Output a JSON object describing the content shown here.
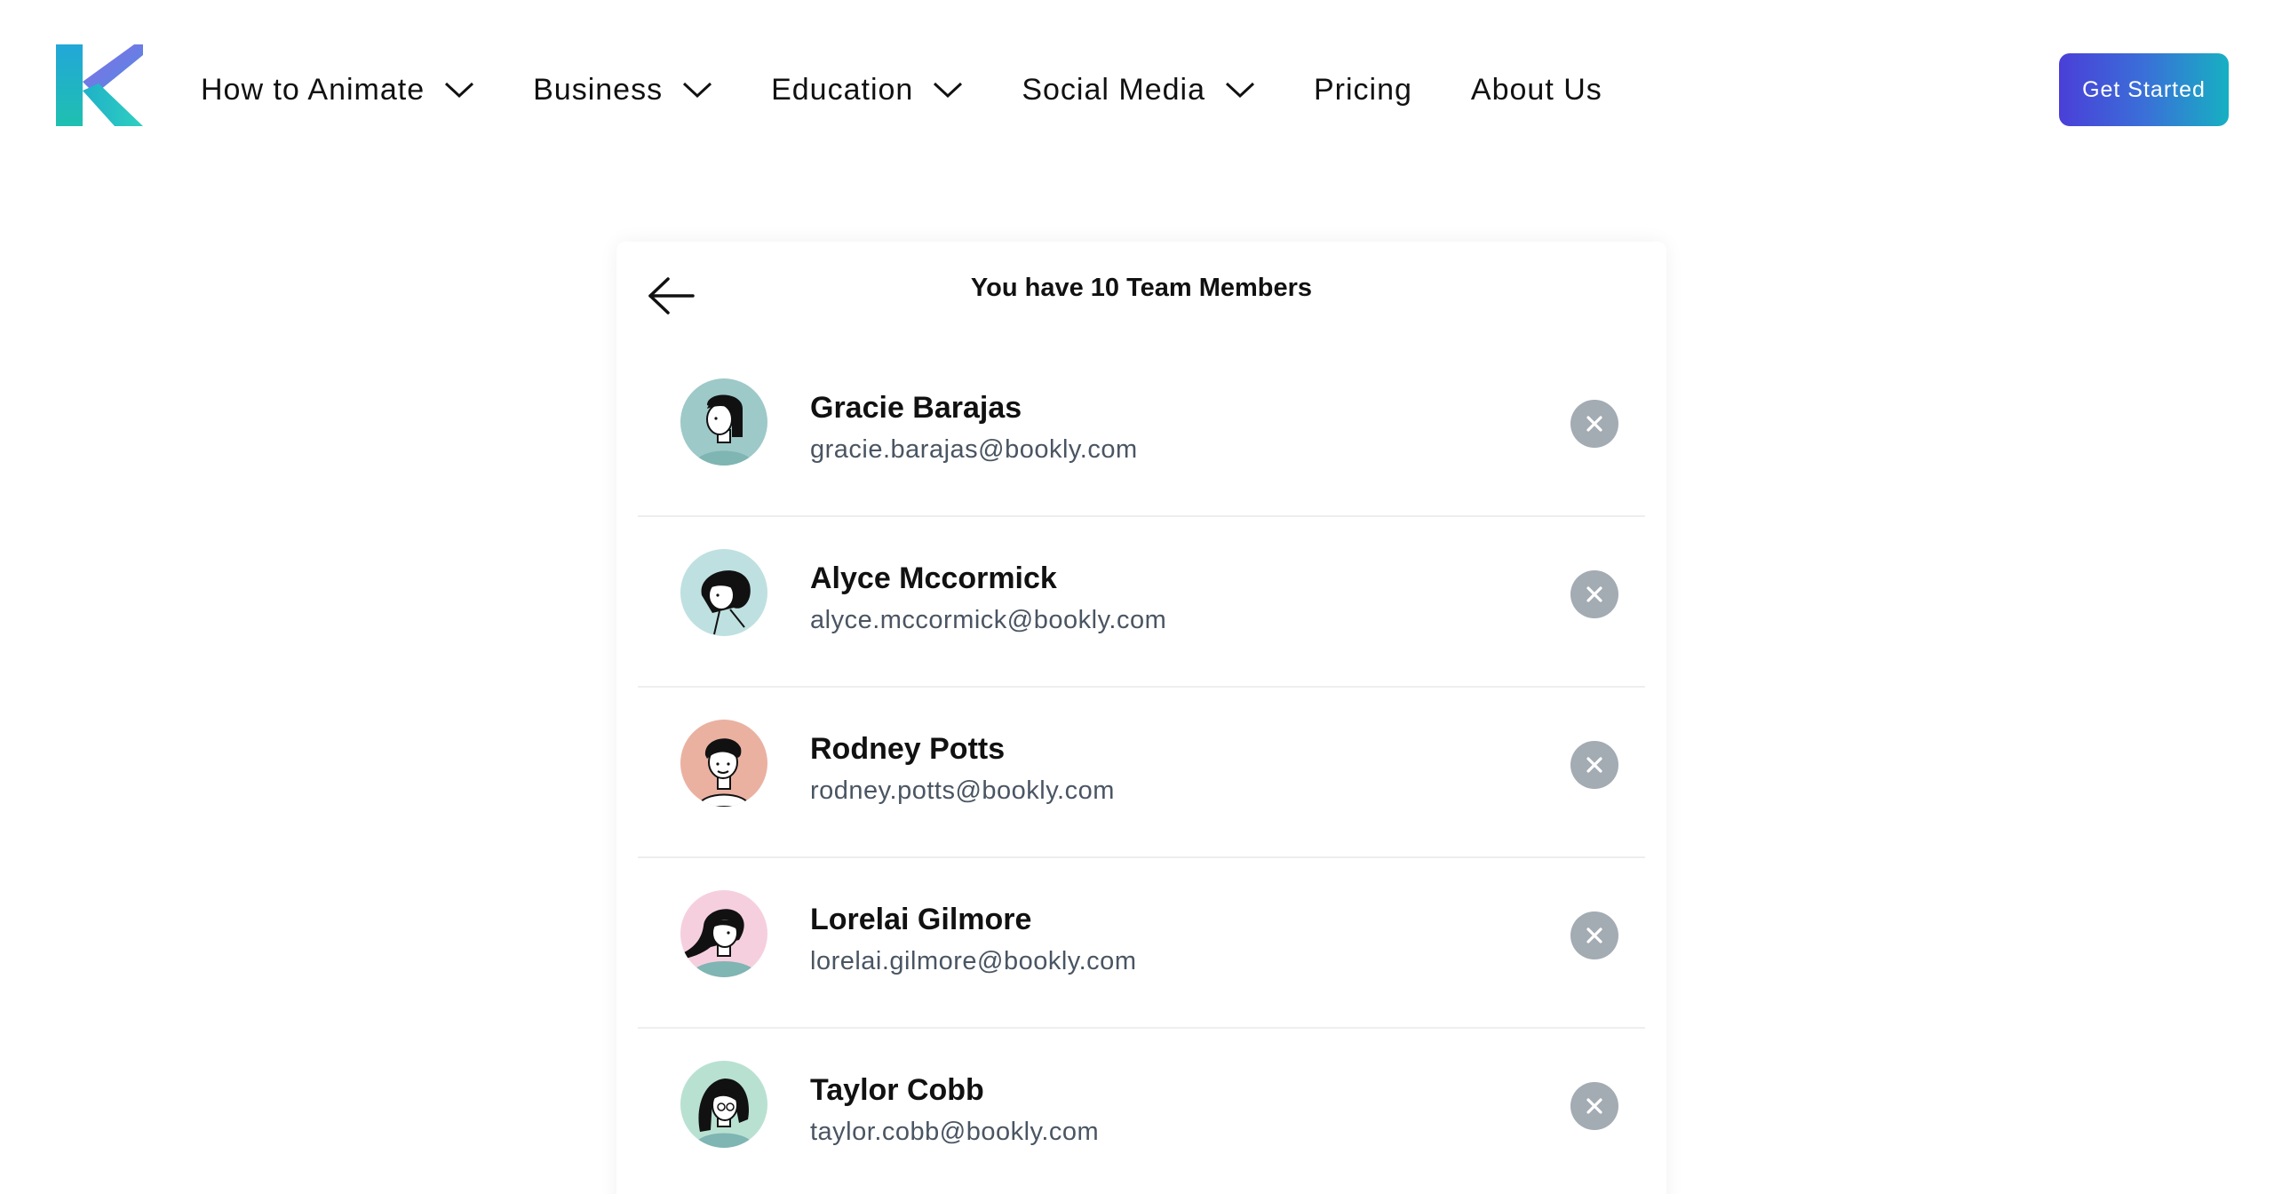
{
  "header": {
    "logo_icon": "k-logo-icon",
    "nav": [
      {
        "label": "How to Animate",
        "has_dropdown": true
      },
      {
        "label": "Business",
        "has_dropdown": true
      },
      {
        "label": "Education",
        "has_dropdown": true
      },
      {
        "label": "Social Media",
        "has_dropdown": true
      },
      {
        "label": "Pricing",
        "has_dropdown": false
      },
      {
        "label": "About Us",
        "has_dropdown": false
      }
    ],
    "cta_label": "Get Started"
  },
  "card": {
    "back_icon": "arrow-left-icon",
    "title": "You have 10 Team Members",
    "members": [
      {
        "name": "Gracie Barajas",
        "email": "gracie.barajas@bookly.com",
        "avatar_bg": "#9dc9c8"
      },
      {
        "name": "Alyce Mccormick",
        "email": "alyce.mccormick@bookly.com",
        "avatar_bg": "#bfe0e0"
      },
      {
        "name": "Rodney Potts",
        "email": "rodney.potts@bookly.com",
        "avatar_bg": "#eab1a1"
      },
      {
        "name": "Lorelai Gilmore",
        "email": "lorelai.gilmore@bookly.com",
        "avatar_bg": "#f6cfdf"
      },
      {
        "name": "Taylor Cobb",
        "email": "taylor.cobb@bookly.com",
        "avatar_bg": "#b9e1d2"
      }
    ],
    "remove_icon": "close-icon"
  },
  "colors": {
    "cta_gradient_start": "#4a3fd8",
    "cta_gradient_end": "#17b0c2",
    "remove_button": "#a3abb3",
    "email_text": "#4a5563"
  }
}
